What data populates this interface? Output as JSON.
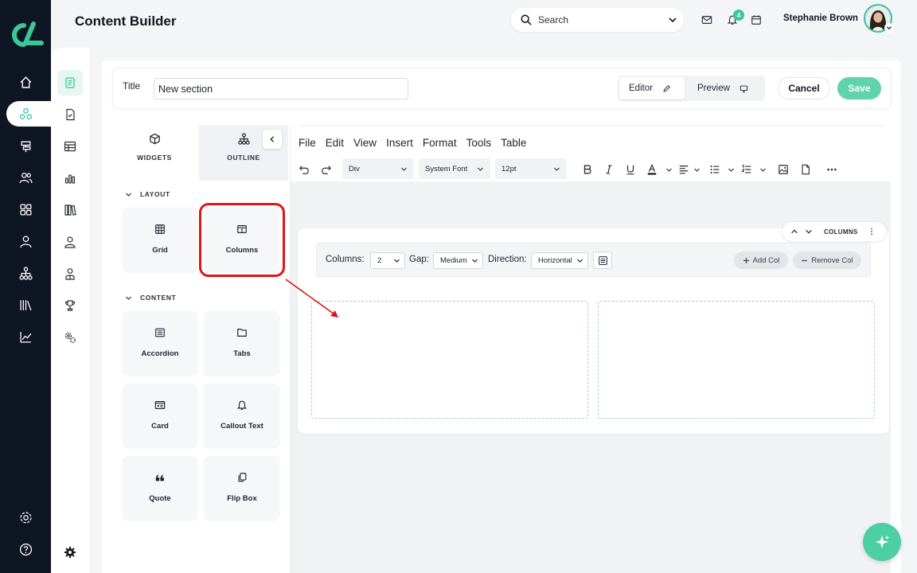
{
  "header": {
    "page_title": "Content Builder",
    "search_placeholder": "Search",
    "notification_count": "4",
    "user_name": "Stephanie Brown"
  },
  "rail": {
    "items": [
      "home-icon",
      "apps-icon",
      "signpost-icon",
      "users-icon",
      "grid-icon",
      "user-icon",
      "hierarchy-icon",
      "library-icon",
      "analytics-icon"
    ],
    "bottom": [
      "settings-icon",
      "help-icon"
    ]
  },
  "title_bar": {
    "label": "Title",
    "value": "New section",
    "editor_label": "Editor",
    "preview_label": "Preview",
    "cancel_label": "Cancel",
    "save_label": "Save"
  },
  "widgets_panel": {
    "tabs": [
      {
        "label": "WIDGETS",
        "icon": "cube-icon"
      },
      {
        "label": "OUTLINE",
        "icon": "tree-icon"
      }
    ],
    "layout_header": "LAYOUT",
    "content_header": "CONTENT",
    "layout_items": [
      {
        "label": "Grid",
        "icon": "grid-icon"
      },
      {
        "label": "Columns",
        "icon": "columns-icon"
      }
    ],
    "content_items": [
      {
        "label": "Accordion",
        "icon": "list-icon"
      },
      {
        "label": "Tabs",
        "icon": "folder-icon"
      },
      {
        "label": "Card",
        "icon": "id-card-icon"
      },
      {
        "label": "Callout Text",
        "icon": "bell-icon"
      },
      {
        "label": "Quote",
        "icon": "quote-icon"
      },
      {
        "label": "Flip Box",
        "icon": "copy-icon"
      }
    ]
  },
  "editor": {
    "menu": [
      "File",
      "Edit",
      "View",
      "Insert",
      "Format",
      "Tools",
      "Table"
    ],
    "block_select": "Div",
    "font_select": "System Font",
    "size_select": "12pt"
  },
  "columns_block": {
    "pill_label": "COLUMNS",
    "columns_label": "Columns:",
    "columns_value": "2",
    "gap_label": "Gap:",
    "gap_value": "Medium",
    "direction_label": "Direction:",
    "direction_value": "Horizontal",
    "add_col_label": "Add Col",
    "remove_col_label": "Remove Col"
  },
  "colors": {
    "accent": "#3cc69a",
    "rail_bg": "#0f1623",
    "highlight": "#e01515"
  }
}
